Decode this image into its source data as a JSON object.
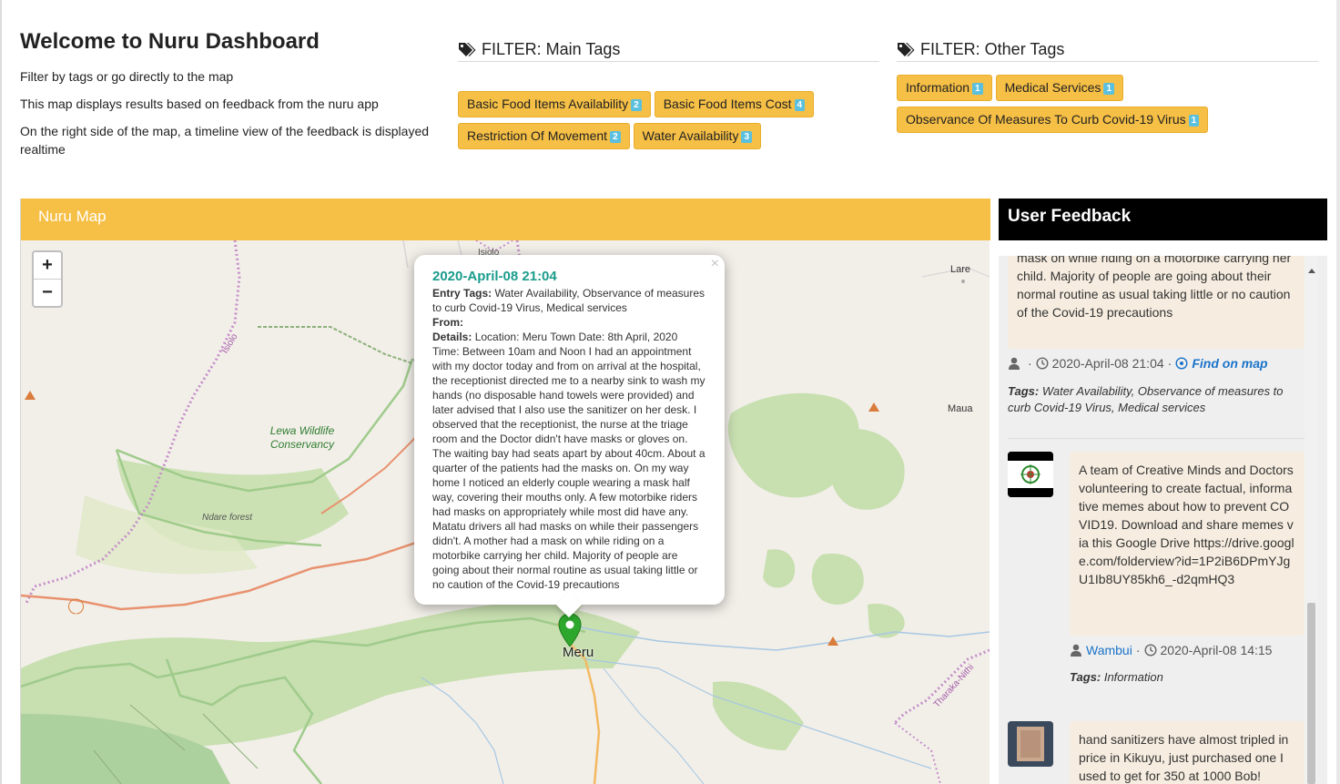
{
  "header": {
    "title": "Welcome to Nuru Dashboard",
    "lines": [
      "Filter by tags or go directly to the map",
      "This map displays results based on feedback from the nuru app",
      "On the right side of the map, a timeline view of the feedback is displayed realtime"
    ]
  },
  "filters": {
    "main": {
      "title": "FILTER: Main Tags",
      "tags": [
        {
          "label": "Basic Food Items Availability",
          "count": "2"
        },
        {
          "label": "Basic Food Items Cost",
          "count": "4"
        },
        {
          "label": "Restriction Of Movement",
          "count": "2"
        },
        {
          "label": "Water Availability",
          "count": "3"
        }
      ]
    },
    "other": {
      "title": "FILTER: Other Tags",
      "tags": [
        {
          "label": "Information",
          "count": "1"
        },
        {
          "label": "Medical Services",
          "count": "1"
        },
        {
          "label": "Observance Of Measures To Curb Covid-19 Virus",
          "count": "1"
        }
      ]
    }
  },
  "map": {
    "title": "Nuru Map",
    "zoom_in": "+",
    "zoom_out": "−",
    "place_labels": {
      "isiolo_town": "Isiolo",
      "isiolo_border": "Isiolo",
      "lare": "Lare",
      "maua": "Maua",
      "lewa": "Lewa Wildlife\nConservancy",
      "ndare": "Ndare forest",
      "tharaka": "Tharaka-Nithi",
      "meru": "Meru"
    },
    "popup": {
      "close": "×",
      "date": "2020-April-08 21:04",
      "entry_tags_label": "Entry Tags:",
      "entry_tags": "Water Availability, Observance of measures to curb Covid-19 Virus, Medical services",
      "from_label": "From:",
      "details_label": "Details:",
      "details": "Location: Meru Town Date: 8th April, 2020 Time: Between 10am and Noon I had an appointment with my doctor today and from on arrival at the hospital, the receptionist directed me to a nearby sink to wash my hands (no disposable hand towels were provided) and later advised that I also use the sanitizer on her desk. I observed that the receptionist, the nurse at the triage room and the Doctor didn't have masks or gloves on. The waiting bay had seats apart by about 40cm. About a quarter of the patients had the masks on. On my way home I noticed an elderly couple wearing a mask half way, covering their mouths only. A few motorbike riders had masks on appropriately while most did have any. Matatu drivers all had masks on while their passengers didn't. A mother had a mask on while riding on a motorbike carrying her child. Majority of people are going about their normal routine as usual taking little or no caution of the Covid-19 precautions"
    }
  },
  "feedback": {
    "title": "User Feedback",
    "items": [
      {
        "text": "mask on while riding on a motorbike carrying her child. Majority of people are going about their normal routine as usual taking little or no caution of the Covid-19 precautions",
        "user": "",
        "separator": "·",
        "date": "2020-April-08 21:04",
        "find_on_map": "Find on map",
        "tags_label": "Tags:",
        "tags": "Water Availability, Observance of measures to curb Covid-19 Virus, Medical services"
      },
      {
        "text": "A team of Creative Minds and Doctors volunteering to create factual, informative memes about how to prevent COVID19. Download and share memes via this Google Drive https://drive.google.com/folderview?id=1P2iB6DPmYJgU1Ib8UY85kh6_-d2qmHQ3",
        "user": "Wambui",
        "separator": "·",
        "date": "2020-April-08 14:15",
        "tags_label": "Tags:",
        "tags": "Information"
      },
      {
        "text": "hand sanitizers have almost tripled in price in Kikuyu, just purchased one I used to get for 350 at 1000 Bob!"
      }
    ]
  },
  "colors": {
    "accent": "#f6bf45",
    "badge": "#5bc0de",
    "popup_title": "#1a9c8c",
    "marker": "#2da82d",
    "feedback_header": "#000000",
    "bubble": "#f6ede0"
  }
}
